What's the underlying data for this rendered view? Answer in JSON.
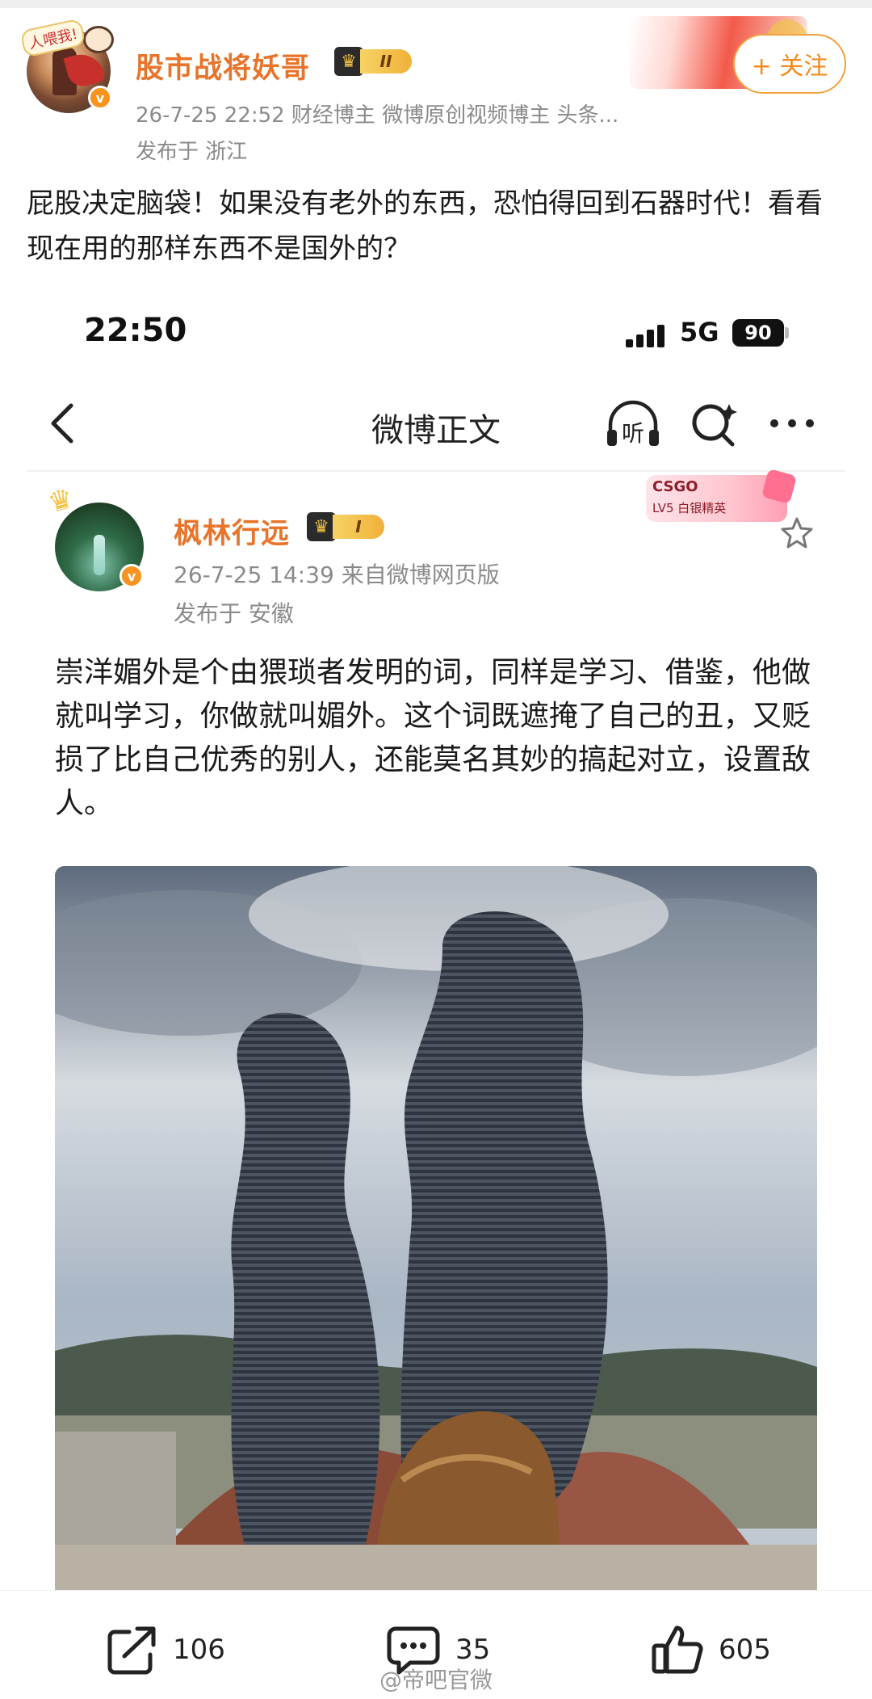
{
  "outer_post": {
    "avatar_sticker": "人喂我!",
    "author": "股市战将妖哥",
    "level_badge": "II",
    "meta": "26-7-25 22:52   财经博主 微博原创视频博主 头条...",
    "location": "发布于 浙江",
    "follow_label": "+ 关注",
    "text": "屁股决定脑袋！如果没有老外的东西，恐怕得回到石器时代！看看现在用的那样东西不是国外的？"
  },
  "embedded_screenshot": {
    "status_time": "22:50",
    "network": "5G",
    "battery": "90",
    "nav_title": "微博正文",
    "listen_label": "听",
    "post": {
      "author": "枫林行远",
      "level_badge": "I",
      "meta": "26-7-25 14:39  来自微博网页版",
      "location": "发布于 安徽",
      "fan_badge_game": "CSGO",
      "fan_badge_level": "LV5 白银精英",
      "text": "崇洋媚外是个由猥琐者发明的词，同样是学习、借鉴，他做就叫学习，你做就叫媚外。这个词既遮掩了自己的丑，又贬损了比自己优秀的别人，还能莫名其妙的搞起对立，设置敌人。",
      "image_desc_icon": "photo-of-two-layered-metal-sculptures"
    }
  },
  "actions": {
    "share_count": "106",
    "comment_count": "35",
    "like_count": "605"
  },
  "watermark": "@帝吧官微",
  "colors": {
    "accent_orange": "#e8742a",
    "follow_border": "#f3a23b",
    "verified": "#f7931e"
  }
}
